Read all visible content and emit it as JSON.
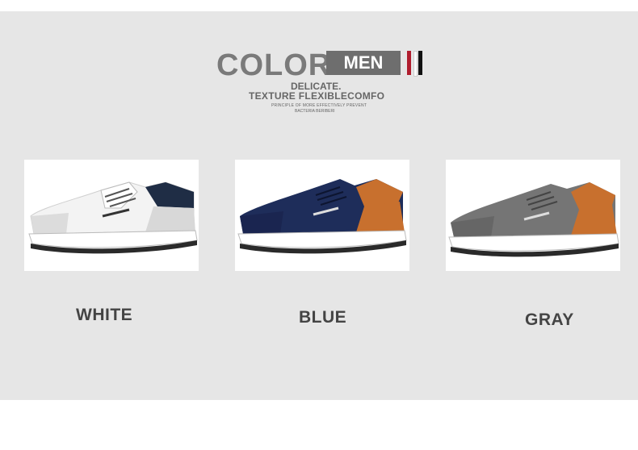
{
  "header": {
    "color_word": "COLOR",
    "men_label": "MEN",
    "line1": "DELICATE.",
    "line2": "TEXTURE FLEXIBLECOMFO",
    "line3": "PRINCIPLE OF MORE EFFECTIVELY PREVENT",
    "line4": "BACTERIA BERIBERI"
  },
  "colors": {
    "panel_bg": "#e6e6e6",
    "men_box": "#6e6e6e",
    "stripe_red": "#b01d2e",
    "stripe_black": "#111111"
  },
  "products": [
    {
      "label": "WHITE",
      "image": "white-sneaker"
    },
    {
      "label": "BLUE",
      "image": "blue-sneaker"
    },
    {
      "label": "GRAY",
      "image": "gray-sneaker"
    }
  ]
}
